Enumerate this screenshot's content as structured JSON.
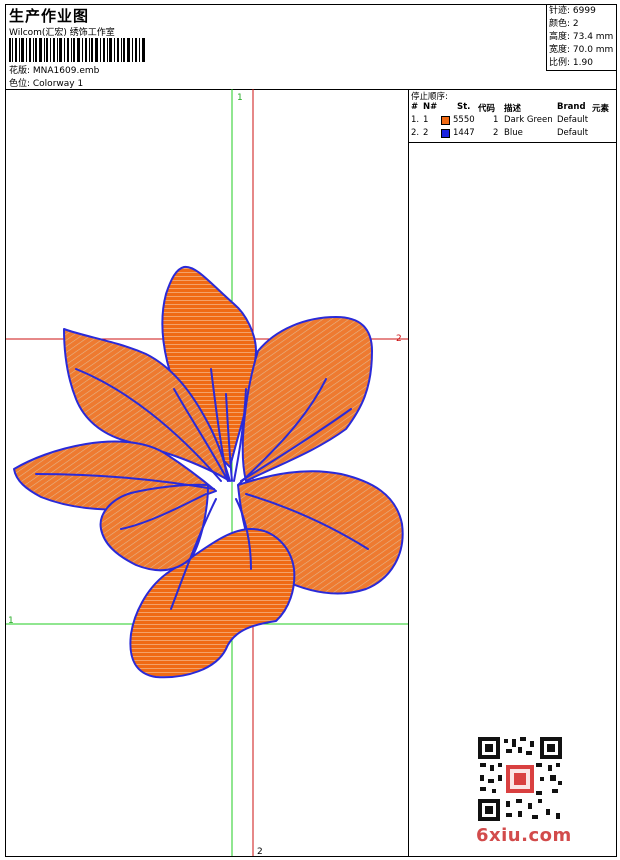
{
  "header": {
    "title": "生产作业图",
    "company": "Wilcom(汇宏) 绣饰工作室",
    "design": "花版:  MNA1609.emb",
    "colorway": "色位:  Colorway 1"
  },
  "specs": [
    "针迹: 6999",
    "颜色: 2",
    "高度: 73.4 mm",
    "宽度: 70.0 mm",
    "比例: 1.90"
  ],
  "stop_sequence": {
    "title": "停止顺序:",
    "headers": {
      "idx": "#",
      "num": "N#",
      "st": "St.",
      "code": "代码",
      "desc": "描述",
      "brand": "Brand",
      "element": "元素"
    },
    "rows": [
      {
        "idx": "1.",
        "num": "1",
        "color": "#f06a14",
        "st": "5550",
        "code": "1",
        "desc": "Dark Green",
        "brand": "Default"
      },
      {
        "idx": "2.",
        "num": "2",
        "color": "#1a22e0",
        "st": "1447",
        "code": "2",
        "desc": "Blue",
        "brand": "Default"
      }
    ]
  },
  "crosshair_labels": {
    "top": "1",
    "right": "2",
    "left": "1",
    "bottom": "2"
  },
  "colors": {
    "fill": "#f06a14",
    "outline": "#2a2ad8",
    "guide_green": "#22cc22",
    "guide_red": "#cc1111"
  },
  "watermark": "6xiu.com"
}
